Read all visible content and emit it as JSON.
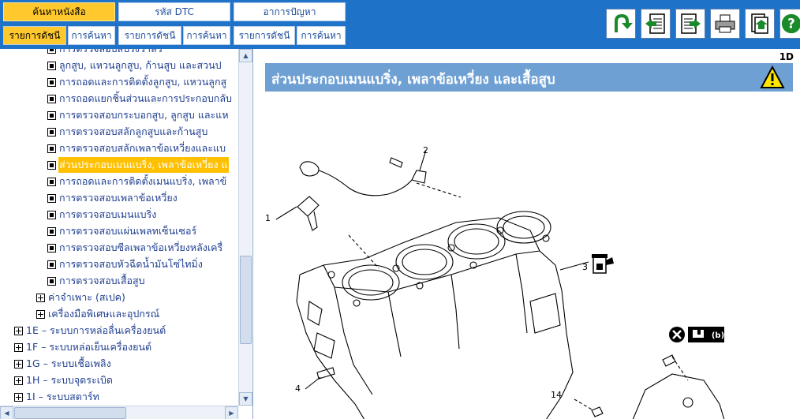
{
  "header": {
    "tabs": [
      {
        "label": "ค้นหาหนังสือ",
        "active": true
      },
      {
        "label": "รหัส DTC",
        "active": false
      },
      {
        "label": "อาการปัญหา",
        "active": false
      }
    ],
    "subtabs": [
      {
        "label": "รายการดัชนี",
        "active": true
      },
      {
        "label": "การค้นหา",
        "active": false
      },
      {
        "label": "รายการดัชนี",
        "active": false
      },
      {
        "label": "การค้นหา",
        "active": false
      },
      {
        "label": "รายการดัชนี",
        "active": false
      },
      {
        "label": "การค้นหา",
        "active": false
      }
    ],
    "tools": [
      "back-arrow-icon",
      "previous-page-icon",
      "next-page-icon",
      "print-icon",
      "bookmark-export-icon",
      "help-icon"
    ]
  },
  "tree": {
    "items": [
      {
        "label": "การตรวจสอบสปริงวาล์ว",
        "type": "doc",
        "selected": false
      },
      {
        "label": "ลูกสูบ, แหวนลูกสูบ, ก้านสูบ และสวนป",
        "type": "doc",
        "selected": false
      },
      {
        "label": "การถอดและการติดตั้งลูกสูบ, แหวนลูกสู",
        "type": "doc",
        "selected": false
      },
      {
        "label": "การถอดแยกชิ้นส่วนและการประกอบกลับ",
        "type": "doc",
        "selected": false
      },
      {
        "label": "การตรวจสอบกระบอกสูบ, ลูกสูบ และแห",
        "type": "doc",
        "selected": false
      },
      {
        "label": "การตรวจสอบสลักลูกสูบและก้านสูบ",
        "type": "doc",
        "selected": false
      },
      {
        "label": "การตรวจสอบสลักเพลาข้อเหวี่ยงและแบ",
        "type": "doc",
        "selected": false
      },
      {
        "label": "ส่วนประกอบเมนแบริ่ง, เพลาข้อเหวี่ยง แ",
        "type": "doc",
        "selected": true
      },
      {
        "label": "การถอดและการติดตั้งเมนแบริ่ง, เพลาข้",
        "type": "doc",
        "selected": false
      },
      {
        "label": "การตรวจสอบเพลาข้อเหวี่ยง",
        "type": "doc",
        "selected": false
      },
      {
        "label": "การตรวจสอบเมนแบริ่ง",
        "type": "doc",
        "selected": false
      },
      {
        "label": "การตรวจสอบแผ่นเพลทเซ็นเซอร์",
        "type": "doc",
        "selected": false
      },
      {
        "label": "การตรวจสอบซีลเพลาข้อเหวี่ยงหลังเครื่",
        "type": "doc",
        "selected": false
      },
      {
        "label": "การตรวจสอบหัวฉีดน้ำมันโซ่ไทมิ่ง",
        "type": "doc",
        "selected": false
      },
      {
        "label": "การตรวจสอบเสื้อสูบ",
        "type": "doc",
        "selected": false
      },
      {
        "label": "ค่าจำเพาะ (สเปค)",
        "type": "folder",
        "selected": false
      },
      {
        "label": "เครื่องมือพิเศษและอุปกรณ์",
        "type": "folder",
        "selected": false
      },
      {
        "label": "1E – ระบบการหล่อลื่นเครื่องยนต์",
        "type": "folder",
        "selected": false
      },
      {
        "label": "1F – ระบบหล่อเย็นเครื่องยนต์",
        "type": "folder",
        "selected": false
      },
      {
        "label": "1G – ระบบเชื้อเพลิง",
        "type": "folder",
        "selected": false
      },
      {
        "label": "1H – ระบบจุดระเบิด",
        "type": "folder",
        "selected": false
      },
      {
        "label": "1I – ระบบสตาร์ท",
        "type": "folder",
        "selected": false
      }
    ]
  },
  "content": {
    "section_code": "1D",
    "title": "ส่วนประกอบเมนแบริ่ง, เพลาข้อเหวี่ยง และเสื้อสูบ",
    "callouts": [
      "1",
      "2",
      "3",
      "4",
      "14"
    ],
    "torque_symbol_label": "(b)"
  },
  "colors": {
    "header_bg": "#1e73c8",
    "active_tab": "#ffc82c",
    "title_bar": "#6fa0d3",
    "tree_text": "#1f3f90",
    "selection": "#ffc000"
  }
}
